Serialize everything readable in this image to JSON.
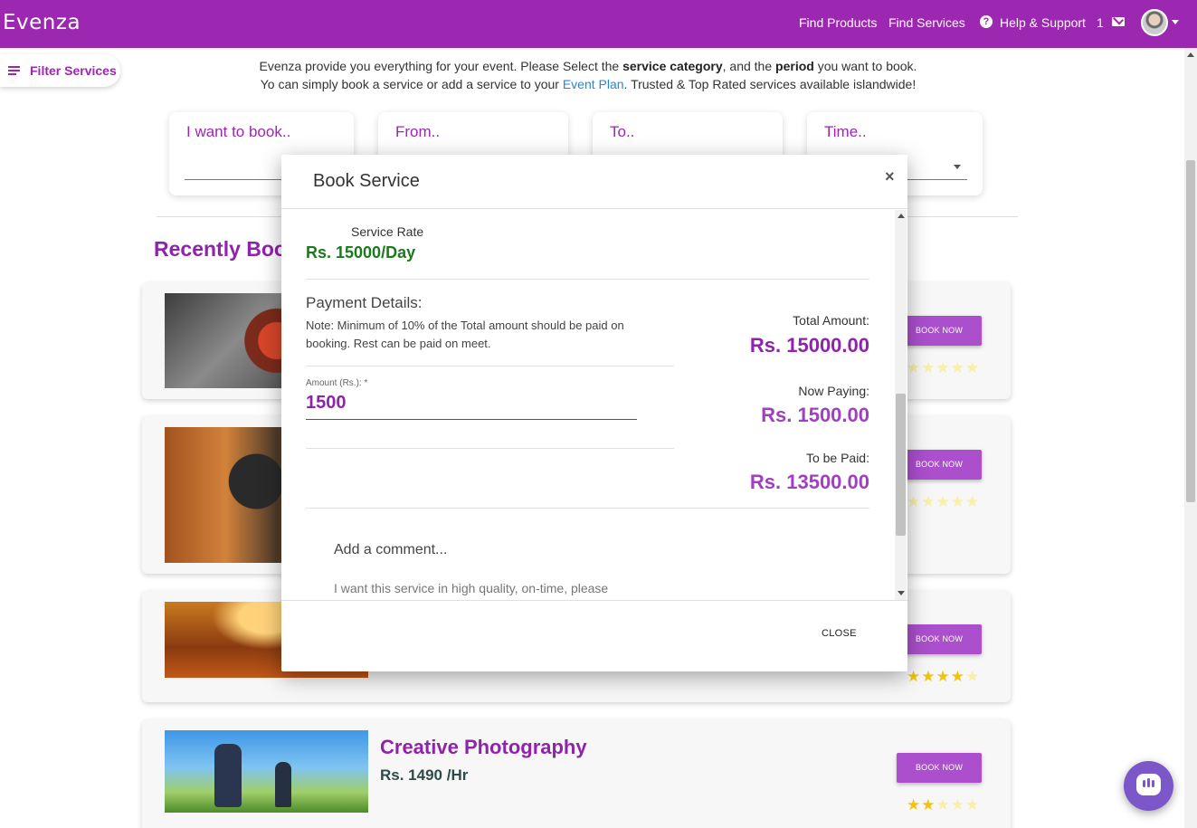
{
  "navbar": {
    "brand": "Evenza",
    "links": [
      "Find Products",
      "Find Services",
      "Help & Support"
    ],
    "message_count": "1",
    "icons": [
      "help-circle-icon",
      "envelope-icon",
      "avatar",
      "caret-down-icon"
    ]
  },
  "filter": {
    "label": "Filter Services",
    "icon": "menu-list-icon"
  },
  "intro": {
    "line1_a": "Evenza provide you everything for your event. Please Select the ",
    "line1_b": "service category",
    "line1_c": ", and the ",
    "line1_d": "period",
    "line1_e": " you want to book.",
    "line2_a": "Yo can simply book a service or add a service to your ",
    "line2_link": "Event Plan",
    "line2_b": ". Trusted & Top Rated services available islandwide!"
  },
  "search": {
    "book": "I want to book..",
    "from": "From..",
    "to": "To..",
    "time": "Time.."
  },
  "section_title": "Recently Booked",
  "services": [
    {
      "book_label": "BOOK NOW",
      "rating": 5
    },
    {
      "book_label": "BOOK NOW",
      "rating": 5
    },
    {
      "book_label": "BOOK NOW",
      "rating": 4
    },
    {
      "title": "Creative Photography",
      "price": "Rs. 1490 /Hr",
      "book_label": "BOOK NOW",
      "rating": 2
    }
  ],
  "modal": {
    "title": "Book Service",
    "close_icon": "×",
    "service_rate_label": "Service Rate",
    "service_rate_value": "Rs. 15000/Day",
    "payment_heading": "Payment Details:",
    "payment_note": "Note: Minimum of 10% of the Total amount should be paid on booking. Rest can be paid on meet.",
    "amount_label": "Amount (Rs.): *",
    "amount_value": "1500",
    "total_label": "Total Amount:",
    "total_value": "Rs. 15000.00",
    "now_paying_label": "Now Paying:",
    "now_paying_value": "Rs. 1500.00",
    "to_be_paid_label": "To be Paid:",
    "to_be_paid_value": "Rs. 13500.00",
    "comment_label": "Add a comment...",
    "comment_text": "I want this service in high quality, on-time, please",
    "close_button": "CLOSE"
  },
  "colors": {
    "brand": "#9c27b0",
    "accent_button": "#ab4fcd",
    "rate_green": "#1b7a1b",
    "link_blue": "#1e88e5",
    "star": "#f4c20d"
  }
}
